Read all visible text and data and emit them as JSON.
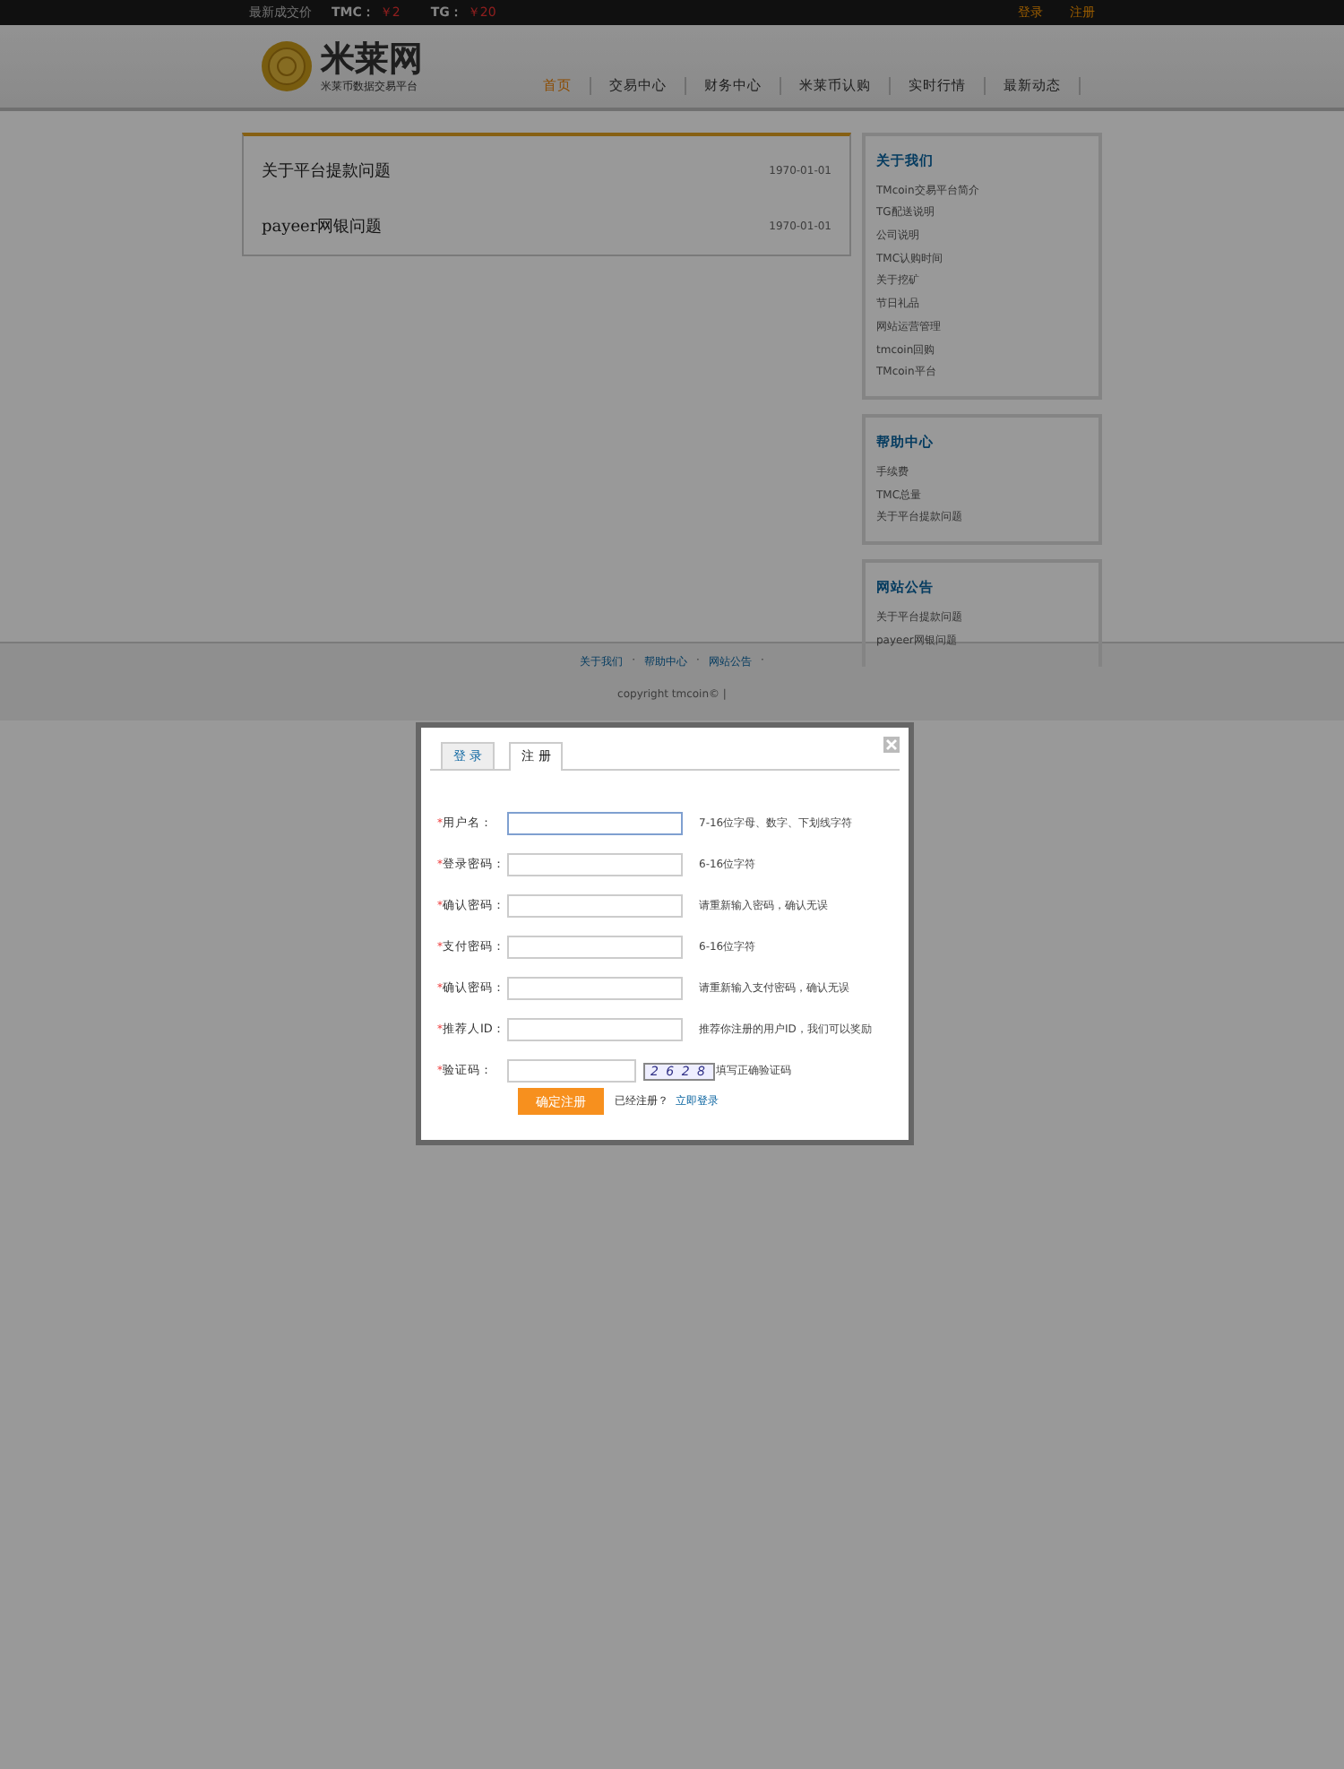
{
  "top_bar": {
    "price_label": "最新成交价",
    "prices": [
      {
        "label": "TMC：",
        "value": "￥2"
      },
      {
        "label": "TG：",
        "value": "￥20"
      }
    ],
    "links": [
      "登录",
      "注册"
    ]
  },
  "header": {
    "logo": "米莱网",
    "slogan": "米莱币数据交易平台",
    "nav": [
      {
        "label": "首页",
        "selected": true
      },
      {
        "label": "交易中心",
        "selected": false
      },
      {
        "label": "财务中心",
        "selected": false
      },
      {
        "label": "米莱币认购",
        "selected": false
      },
      {
        "label": "实时行情",
        "selected": false
      },
      {
        "label": "最新动态",
        "selected": false
      }
    ]
  },
  "news": [
    {
      "title": "关于平台提款问题",
      "date": "1970-01-01"
    },
    {
      "title": "payeer网银问题",
      "date": "1970-01-01"
    }
  ],
  "sidebar": [
    {
      "title": "关于我们",
      "items": [
        "TMcoin交易平台简介",
        "TG配送说明",
        "公司说明",
        "TMC认购时间",
        "关于挖矿",
        "节日礼品",
        "网站运营管理",
        "tmcoin回购",
        "TMcoin平台"
      ]
    },
    {
      "title": "帮助中心",
      "items": [
        "手续费",
        "TMC总量",
        "关于平台提款问题"
      ]
    },
    {
      "title": "网站公告",
      "items": [
        "关于平台提款问题",
        "payeer网银问题"
      ]
    }
  ],
  "footer": {
    "links": [
      {
        "label": "关于我们",
        "separator": "·"
      },
      {
        "label": "帮助中心",
        "separator": "·"
      },
      {
        "label": "网站公告",
        "separator": "·"
      }
    ],
    "copyright": "copyright tmcoin© |"
  },
  "dialog": {
    "tabs": [
      {
        "label": "登 录",
        "selected": false
      },
      {
        "label": "注 册",
        "selected": true
      }
    ],
    "fields": [
      {
        "required_mark": "*",
        "label": "用户名：",
        "hint": "7-16位字母、数字、下划线字符",
        "focused": true
      },
      {
        "required_mark": "*",
        "label": "登录密码：",
        "hint": "6-16位字符",
        "focused": false
      },
      {
        "required_mark": "*",
        "label": "确认密码：",
        "hint": "请重新输入密码，确认无误",
        "focused": false
      },
      {
        "required_mark": "*",
        "label": "支付密码：",
        "hint": "6-16位字符",
        "focused": false
      },
      {
        "required_mark": "*",
        "label": "确认密码：",
        "hint": "请重新输入支付密码，确认无误",
        "focused": false
      },
      {
        "required_mark": "*",
        "label": "推荐人ID：",
        "hint": "推荐你注册的用户ID，我们可以奖励",
        "focused": false
      }
    ],
    "captcha": {
      "required_mark": "*",
      "label": "验证码：",
      "code": "2 6 2 8",
      "hint": "填写正确验证码"
    },
    "submit": "确定注册",
    "login_prompt": "已经注册？",
    "login_link": "立即登录"
  }
}
